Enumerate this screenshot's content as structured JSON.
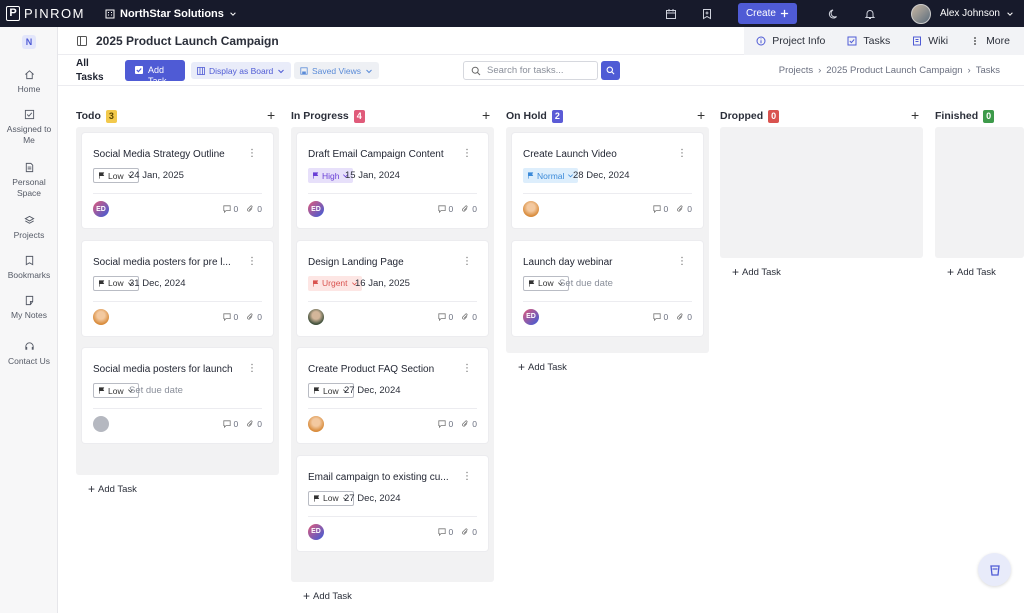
{
  "topbar": {
    "logo_letter": "P",
    "logo_text": "PINROM",
    "org_name": "NorthStar Solutions",
    "create_label": "Create",
    "user_name": "Alex Johnson"
  },
  "sidebar": {
    "workspace_initial": "N",
    "items": [
      {
        "label": "Home",
        "icon": "home-icon"
      },
      {
        "label": "Assigned to Me",
        "icon": "check-square-icon"
      },
      {
        "label": "Personal Space",
        "icon": "document-icon"
      },
      {
        "label": "Projects",
        "icon": "layers-icon"
      },
      {
        "label": "Bookmarks",
        "icon": "bookmark-icon"
      },
      {
        "label": "My Notes",
        "icon": "note-icon"
      },
      {
        "label": "Contact Us",
        "icon": "headset-icon"
      }
    ]
  },
  "header": {
    "title": "2025 Product Launch Campaign",
    "tabs": [
      {
        "label": "Project Info",
        "icon": "info-icon"
      },
      {
        "label": "Tasks",
        "icon": "check-square-icon"
      },
      {
        "label": "Wiki",
        "icon": "book-icon"
      },
      {
        "label": "More",
        "icon": "kebab-icon"
      }
    ]
  },
  "toolbar": {
    "all_tasks_label": "All Tasks",
    "add_task_label": "Add Task",
    "display_label": "Display as Board",
    "saved_views_label": "Saved Views",
    "search_placeholder": "Search for tasks...",
    "breadcrumb": [
      "Projects",
      "2025 Product Launch Campaign",
      "Tasks"
    ]
  },
  "board": {
    "add_task_label": "Add Task",
    "columns": [
      {
        "name": "Todo",
        "count": "3",
        "count_color": "#f2c94c",
        "cards": [
          {
            "title": "Social Media Strategy Outline",
            "priority": "Low",
            "due": "24 Jan, 2025",
            "assignee": "ED",
            "comments": "0",
            "attachments": "0"
          },
          {
            "title": "Social media posters for pre l...",
            "priority": "Low",
            "due": "31 Dec, 2024",
            "assignee": "",
            "comments": "0",
            "attachments": "0"
          },
          {
            "title": "Social media posters for launch",
            "priority": "Low",
            "due": "Set due date",
            "assignee": "",
            "comments": "0",
            "attachments": "0"
          }
        ]
      },
      {
        "name": "In Progress",
        "count": "4",
        "count_color": "#e05b7a",
        "cards": [
          {
            "title": "Draft Email Campaign Content",
            "priority": "High",
            "due": "15 Jan, 2024",
            "assignee": "ED",
            "comments": "0",
            "attachments": "0"
          },
          {
            "title": "Design Landing Page",
            "priority": "Urgent",
            "due": "16 Jan, 2025",
            "assignee": "",
            "comments": "0",
            "attachments": "0"
          },
          {
            "title": "Create Product FAQ Section",
            "priority": "Low",
            "due": "27 Dec, 2024",
            "assignee": "",
            "comments": "0",
            "attachments": "0"
          },
          {
            "title": "Email campaign to existing cu...",
            "priority": "Low",
            "due": "27 Dec, 2024",
            "assignee": "ED",
            "comments": "0",
            "attachments": "0"
          }
        ]
      },
      {
        "name": "On Hold",
        "count": "2",
        "count_color": "#5b5bd6",
        "cards": [
          {
            "title": "Create Launch Video",
            "priority": "Normal",
            "due": "28 Dec, 2024",
            "assignee": "",
            "comments": "0",
            "attachments": "0"
          },
          {
            "title": "Launch day webinar",
            "priority": "Low",
            "due": "Set due date",
            "assignee": "ED",
            "comments": "0",
            "attachments": "0"
          }
        ]
      },
      {
        "name": "Dropped",
        "count": "0",
        "count_color": "#d9534f",
        "cards": []
      },
      {
        "name": "Finished",
        "count": "0",
        "count_color": "#3d9a4a",
        "cards": []
      }
    ]
  }
}
